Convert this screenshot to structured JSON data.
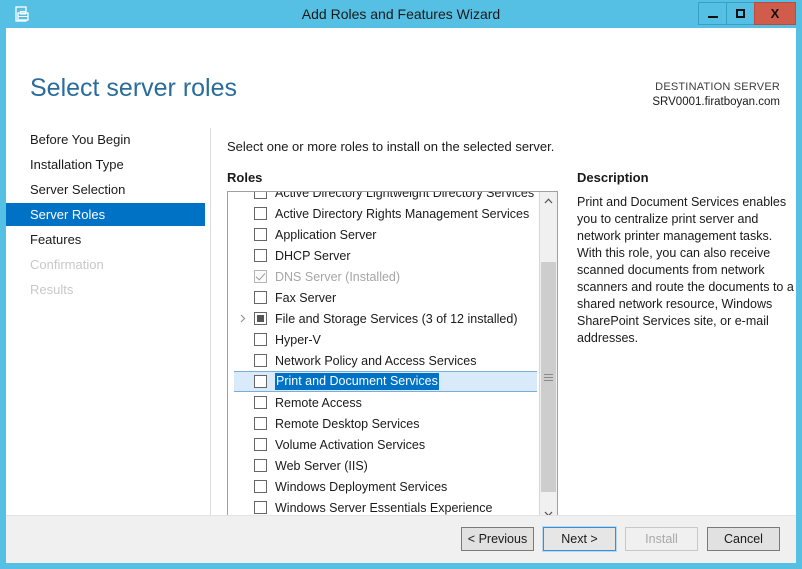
{
  "window": {
    "title": "Add Roles and Features Wizard",
    "icon": "server-manager-icon",
    "minimize_label": "Minimize",
    "maximize_label": "Maximize",
    "close_label": "X",
    "frame_color": "#55c0e4",
    "close_color": "#d05c4c"
  },
  "header": {
    "page_title": "Select server roles",
    "destination_label": "DESTINATION SERVER",
    "destination_server": "SRV0001.firatboyan.com",
    "title_color": "#2a6c9c"
  },
  "nav": {
    "items": [
      {
        "label": "Before You Begin",
        "state": "normal"
      },
      {
        "label": "Installation Type",
        "state": "normal"
      },
      {
        "label": "Server Selection",
        "state": "normal"
      },
      {
        "label": "Server Roles",
        "state": "selected"
      },
      {
        "label": "Features",
        "state": "normal"
      },
      {
        "label": "Confirmation",
        "state": "disabled"
      },
      {
        "label": "Results",
        "state": "disabled"
      }
    ],
    "selected_color": "#0072c6"
  },
  "main": {
    "instruction": "Select one or more roles to install on the selected server.",
    "roles_label": "Roles",
    "description_label": "Description",
    "description_text": "Print and Document Services enables you to centralize print server and network printer management tasks. With this role, you can also receive scanned documents from network scanners and route the documents to a shared network resource, Windows SharePoint Services site, or e-mail addresses."
  },
  "roles_list": [
    {
      "label": "Active Directory Lightweight Directory Services",
      "checkbox": "unchecked",
      "state": "normal",
      "expander": false,
      "clipped": "top"
    },
    {
      "label": "Active Directory Rights Management Services",
      "checkbox": "unchecked",
      "state": "normal",
      "expander": false
    },
    {
      "label": "Application Server",
      "checkbox": "unchecked",
      "state": "normal",
      "expander": false
    },
    {
      "label": "DHCP Server",
      "checkbox": "unchecked",
      "state": "normal",
      "expander": false
    },
    {
      "label": "DNS Server (Installed)",
      "checkbox": "checked",
      "state": "disabled",
      "expander": false
    },
    {
      "label": "Fax Server",
      "checkbox": "unchecked",
      "state": "normal",
      "expander": false
    },
    {
      "label": "File and Storage Services (3 of 12 installed)",
      "checkbox": "partial",
      "state": "normal",
      "expander": true
    },
    {
      "label": "Hyper-V",
      "checkbox": "unchecked",
      "state": "normal",
      "expander": false
    },
    {
      "label": "Network Policy and Access Services",
      "checkbox": "unchecked",
      "state": "normal",
      "expander": false
    },
    {
      "label": "Print and Document Services",
      "checkbox": "unchecked",
      "state": "selected",
      "expander": false
    },
    {
      "label": "Remote Access",
      "checkbox": "unchecked",
      "state": "normal",
      "expander": false
    },
    {
      "label": "Remote Desktop Services",
      "checkbox": "unchecked",
      "state": "normal",
      "expander": false
    },
    {
      "label": "Volume Activation Services",
      "checkbox": "unchecked",
      "state": "normal",
      "expander": false
    },
    {
      "label": "Web Server (IIS)",
      "checkbox": "unchecked",
      "state": "normal",
      "expander": false
    },
    {
      "label": "Windows Deployment Services",
      "checkbox": "unchecked",
      "state": "normal",
      "expander": false
    },
    {
      "label": "Windows Server Essentials Experience",
      "checkbox": "unchecked",
      "state": "normal",
      "expander": false,
      "clipped": "bottom"
    }
  ],
  "scrollbar": {
    "up_arrow": "chevron-up-icon",
    "down_arrow": "chevron-down-icon"
  },
  "footer": {
    "previous_label": "< Previous",
    "next_label": "Next >",
    "install_label": "Install",
    "cancel_label": "Cancel",
    "install_enabled": false,
    "next_is_default": true
  }
}
